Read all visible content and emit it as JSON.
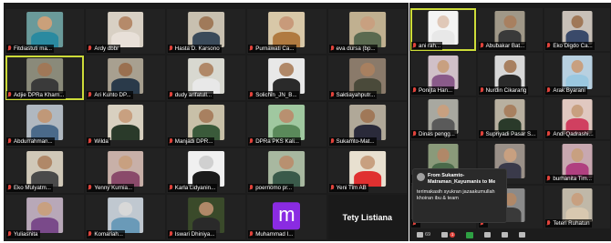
{
  "left_grid": [
    {
      "name": "Fitdiastuti ma...",
      "skin": "#caa07a",
      "shirt": "#2a8aa0",
      "bg": "#6a9a9a"
    },
    {
      "name": "Ardy dbbr",
      "skin": "#b58a6a",
      "shirt": "#e8e0d8",
      "bg": "#d8d0c4"
    },
    {
      "name": "Hasta D. Karsono",
      "skin": "#a07a5a",
      "shirt": "#3a4a5a",
      "bg": "#c8c0b0"
    },
    {
      "name": "Purnawati Ca...",
      "skin": "#c89a7a",
      "shirt": "#b07a40",
      "bg": "#d8c8a8"
    },
    {
      "name": "eva dursa (bp...",
      "skin": "#c8a080",
      "shirt": "#5a6a50",
      "bg": "#c0b090"
    },
    {
      "name": "Adjie DPRa Kharn...",
      "skin": "#a07858",
      "shirt": "#3a3a3a",
      "bg": "#8a8a7a",
      "active": true
    },
    {
      "name": "Ari Kunto DP...",
      "skin": "#9a7050",
      "shirt": "#2a3a4a",
      "bg": "#a8a090"
    },
    {
      "name": "dudy arifatull...",
      "skin": "#b08868",
      "shirt": "#e8e8e8",
      "bg": "#d8d8d0"
    },
    {
      "name": "Solichin_JN_B...",
      "skin": "#b08868",
      "shirt": "#2a2a2a",
      "bg": "#e8e8e8"
    },
    {
      "name": "Saktiayahputr...",
      "skin": "#a88060",
      "shirt": "#4a4a3a",
      "bg": "#8a7a6a"
    },
    {
      "name": "Abdurrahman...",
      "skin": "#c09878",
      "shirt": "#4a6a8a",
      "bg": "#b0b8c0"
    },
    {
      "name": "Wilda",
      "skin": "#c8a080",
      "shirt": "#2a3a2a",
      "bg": "#d8d0c0"
    },
    {
      "name": "Manjadi DPR...",
      "skin": "#a88060",
      "shirt": "#3a5a3a",
      "bg": "#c8c0a8"
    },
    {
      "name": "DPRa PKS Kali...",
      "skin": "#b89070",
      "shirt": "#5a8a5a",
      "bg": "#a0c8a0"
    },
    {
      "name": "Sukamto-Mat...",
      "skin": "#a07858",
      "shirt": "#2a2a3a",
      "bg": "#b0a898"
    },
    {
      "name": "Eko Mulyatm...",
      "skin": "#b08868",
      "shirt": "#4a4a4a",
      "bg": "#d0c8b8"
    },
    {
      "name": "Yenny Kurnia...",
      "skin": "#c8a080",
      "shirt": "#8a4a6a",
      "bg": "#c8b0a8"
    },
    {
      "name": "Karla Lidyanin...",
      "skin": "#d0d0d0",
      "shirt": "#1a1a1a",
      "bg": "#f0f0f0"
    },
    {
      "name": "poernomo pr...",
      "skin": "#b89070",
      "shirt": "#3a5a4a",
      "bg": "#a8b8a0"
    },
    {
      "name": "Yeni Tim AB",
      "skin": "#c8a080",
      "shirt": "#e03030",
      "bg": "#e8e0d0"
    },
    {
      "name": "Yuliasnita",
      "skin": "#c8a080",
      "shirt": "#7a4a8a",
      "bg": "#b8a8b8"
    },
    {
      "name": "Komariah...",
      "skin": "#d8d8d8",
      "shirt": "#6a9ab8",
      "bg": "#c0c8d0"
    },
    {
      "name": "Iswari Dhiniya...",
      "skin": "#b08868",
      "shirt": "#2a2a2a",
      "bg": "#3a4a2a"
    },
    {
      "name": "Muhammad I...",
      "avatar": "m"
    },
    {
      "name": "Tety Listiana",
      "big": true
    }
  ],
  "right_grid": [
    {
      "name": "ani rah...",
      "skin": "#e0c8b8",
      "shirt": "#e8e8e8",
      "bg": "#f4f4f4",
      "active": true
    },
    {
      "name": "Abubakar Bat...",
      "skin": "#a88060",
      "shirt": "#3a3a3a",
      "bg": "#a09888"
    },
    {
      "name": "Eko Digdo Ca...",
      "skin": "#a07858",
      "shirt": "#3a4a6a",
      "bg": "#c8c0b8"
    },
    {
      "name": "Ponijta Han...",
      "skin": "#c8a080",
      "shirt": "#8a5a8a",
      "bg": "#d0c0c8"
    },
    {
      "name": "Nurdin Cikarang",
      "skin": "#a88060",
      "shirt": "#2a2a2a",
      "bg": "#d8d8d8"
    },
    {
      "name": "Arak Byarani",
      "skin": "#c8a080",
      "shirt": "#9ac8e0",
      "bg": "#b8d0e0"
    },
    {
      "name": "Dinas pengg...",
      "skin": "#c8a080",
      "shirt": "#5a5a5a",
      "bg": "#a8a8a0"
    },
    {
      "name": "Supriyadi Pasar S...",
      "skin": "#a88060",
      "shirt": "#2a3a2a",
      "bg": "#b8b0a0"
    },
    {
      "name": "Andi Qadrashi...",
      "skin": "#c8a080",
      "shirt": "#d04060",
      "bg": "#e0c8c0"
    },
    {
      "name": "",
      "skin": "#b08868",
      "shirt": "#4a6a4a",
      "bg": "#8a9a7a"
    },
    {
      "name": "",
      "skin": "#c8a080",
      "shirt": "#3a3a4a",
      "bg": "#9a9088"
    },
    {
      "name": "burhanita Tim...",
      "skin": "#c8a080",
      "shirt": "#b04080",
      "bg": "#c8a8b0"
    },
    {
      "name": "",
      "skin": "#c8a080",
      "shirt": "#5a4a3a",
      "bg": "#a89888"
    },
    {
      "name": "",
      "skin": "#b08868",
      "shirt": "#3a3a3a",
      "bg": "#8a8a8a"
    },
    {
      "name": "Teteri Ruhatun",
      "skin": "#c8a080",
      "shirt": "#d8c8b0",
      "bg": "#c0b8a8"
    }
  ],
  "chat": {
    "from": "From Sukamto-Matraman_Kayumanis to Me",
    "message": "terimakasih syukran jazaakumullah khoiran ibu & team"
  },
  "toolbar": {
    "participants_count": "69",
    "chat_count": "1"
  }
}
